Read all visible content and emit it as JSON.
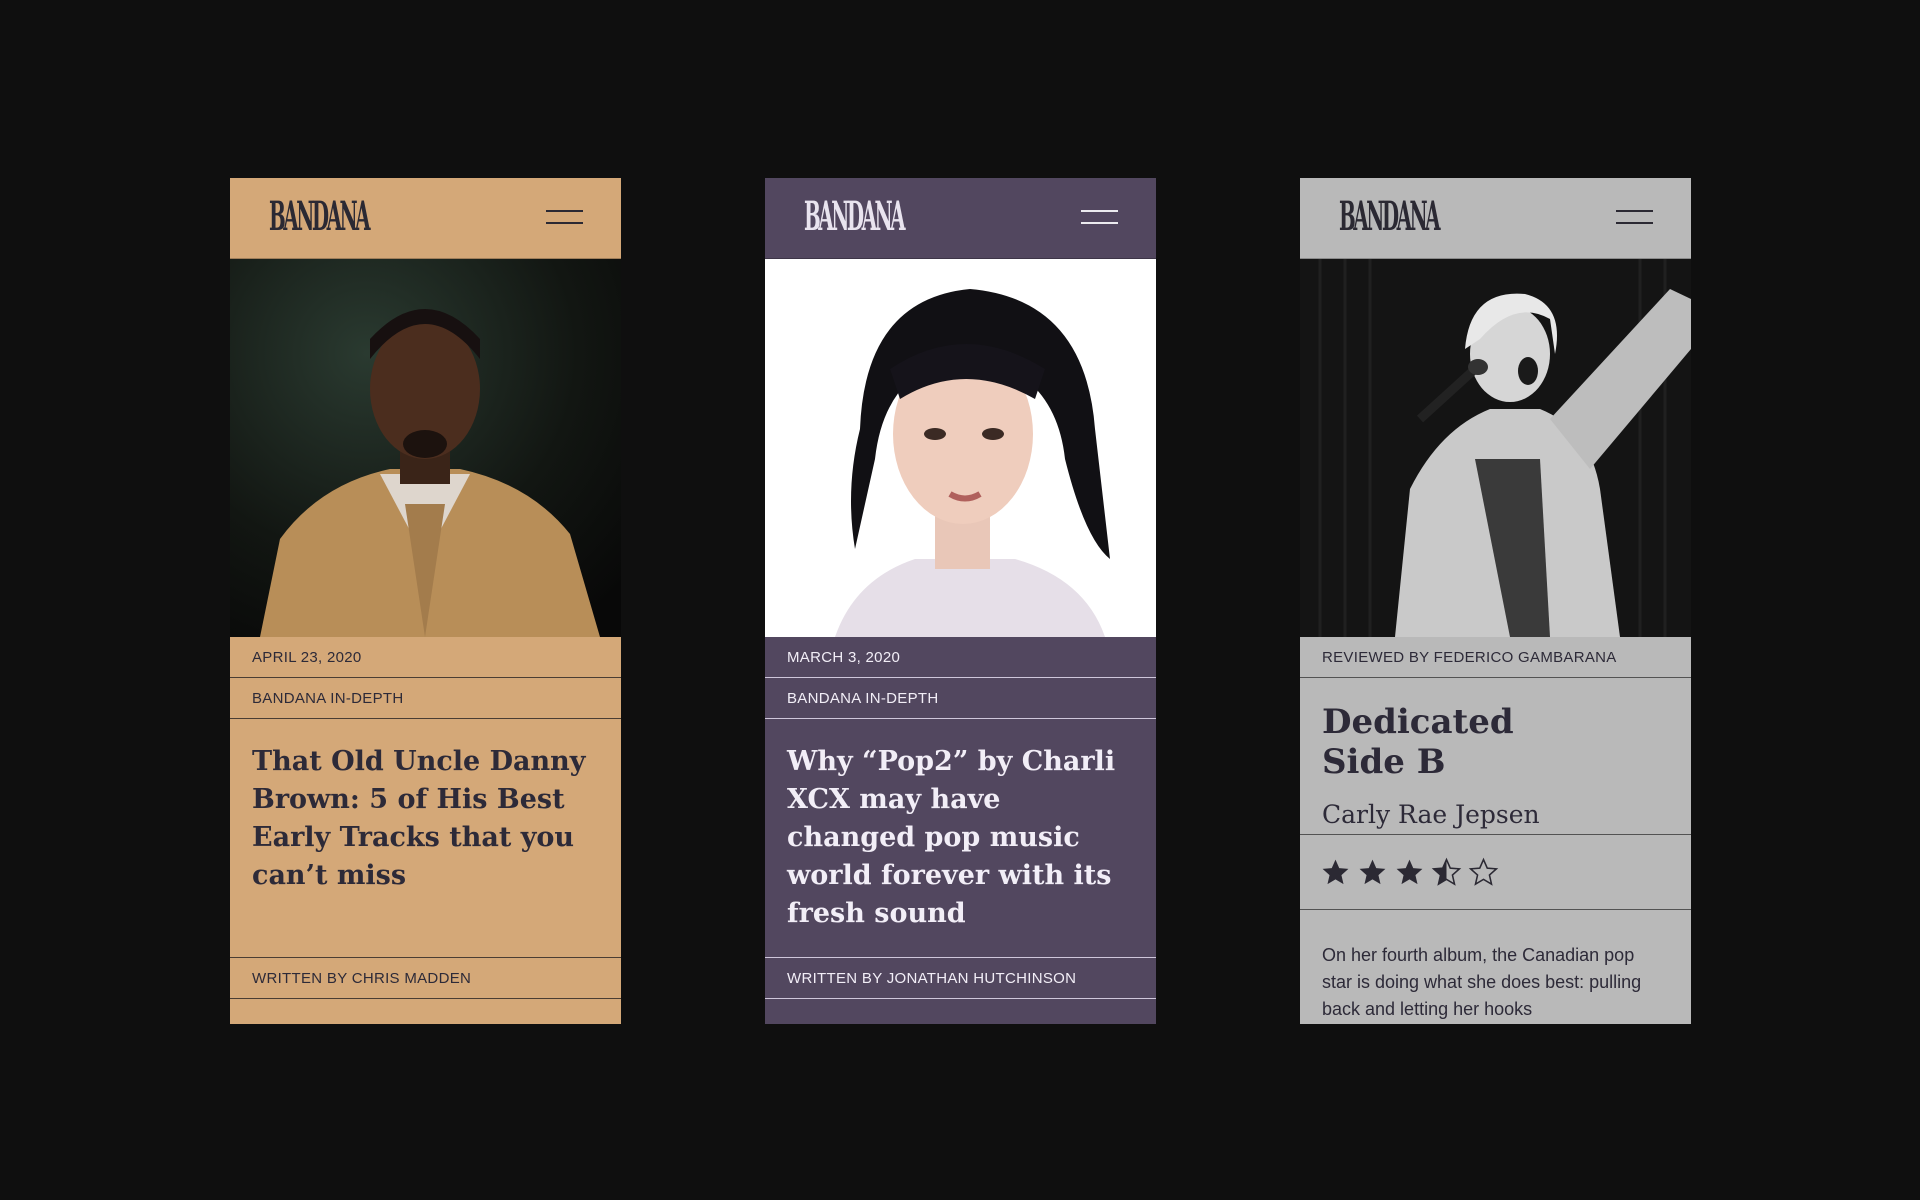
{
  "cards": [
    {
      "logo": "BANDANA",
      "date": "APRIL 23, 2020",
      "section": "BANDANA IN-DEPTH",
      "headline": "That Old Uncle Danny Brown: 5 of His Best Early Tracks that you can’t miss",
      "byline": "WRITTEN BY CHRIS MADDEN"
    },
    {
      "logo": "BANDANA",
      "date": "MARCH 3, 2020",
      "section": "BANDANA IN-DEPTH",
      "headline": "Why “Pop2” by Charli XCX may have changed pop music world forever with its fresh sound",
      "byline": "WRITTEN BY JONATHAN HUTCHINSON"
    },
    {
      "logo": "BANDANA",
      "reviewer": "REVIEWED BY FEDERICO GAMBARANA",
      "album_line1": "Dedicated",
      "album_line2": "Side B",
      "artist": "Carly Rae Jepsen",
      "rating": 3.5,
      "rating_max": 5,
      "excerpt": "On her fourth album, the Canadian pop star is doing what she does best: pulling back and letting her hooks"
    }
  ],
  "colors": {
    "background": "#0f0f0f",
    "orange_card": "#d4a878",
    "purple_card": "#52475f",
    "gray_card": "#b9b9b9",
    "ink": "#2d2a38"
  },
  "icons": [
    "menu-icon",
    "star-icon",
    "star-half-icon",
    "star-outline-icon"
  ]
}
